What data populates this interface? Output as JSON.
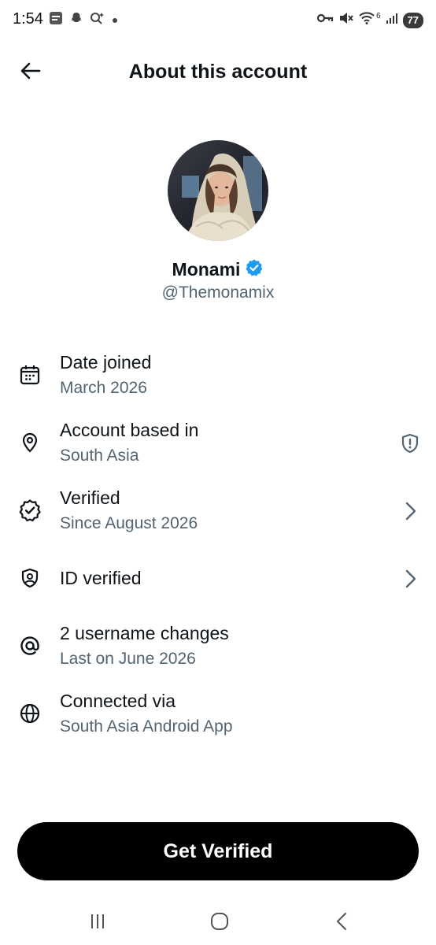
{
  "status_bar": {
    "time": "1:54",
    "battery": "77",
    "signal_label": "6",
    "icons_left": [
      "samsung-news-icon",
      "snapchat-icon",
      "search-sparkle-icon",
      "dot-icon"
    ],
    "icons_right": [
      "vpn-key-icon",
      "mute-icon",
      "wifi-icon",
      "signal-icon",
      "battery-icon"
    ]
  },
  "header": {
    "title": "About this account",
    "back_icon": "arrow-left-icon"
  },
  "profile": {
    "display_name": "Monami",
    "handle": "@Themonamix",
    "verified_badge_color": "#1d9bf0"
  },
  "info_items": [
    {
      "title": "Date joined",
      "subtitle": "March 2026",
      "icon": "calendar-icon"
    },
    {
      "title": "Account based in",
      "subtitle": "South Asia",
      "icon": "location-pin-icon",
      "trailing": "shield-alert-icon"
    },
    {
      "title": "Verified",
      "subtitle": "Since August 2026",
      "icon": "verified-badge-icon",
      "trailing": "chevron-right-icon"
    },
    {
      "title": "ID verified",
      "subtitle": "",
      "icon": "id-shield-icon",
      "trailing": "chevron-right-icon"
    },
    {
      "title": "2 username changes",
      "subtitle": "Last on June 2026",
      "icon": "at-sign-icon"
    },
    {
      "title": "Connected via",
      "subtitle": "South Asia Android App",
      "icon": "globe-icon"
    }
  ],
  "cta": {
    "label": "Get Verified"
  },
  "nav_bar": {
    "buttons": [
      "recents-icon",
      "home-icon",
      "back-icon"
    ]
  },
  "colors": {
    "text_primary": "#0f1419",
    "text_secondary": "#536471",
    "cta_background": "#000000",
    "verified_blue": "#1d9bf0"
  }
}
